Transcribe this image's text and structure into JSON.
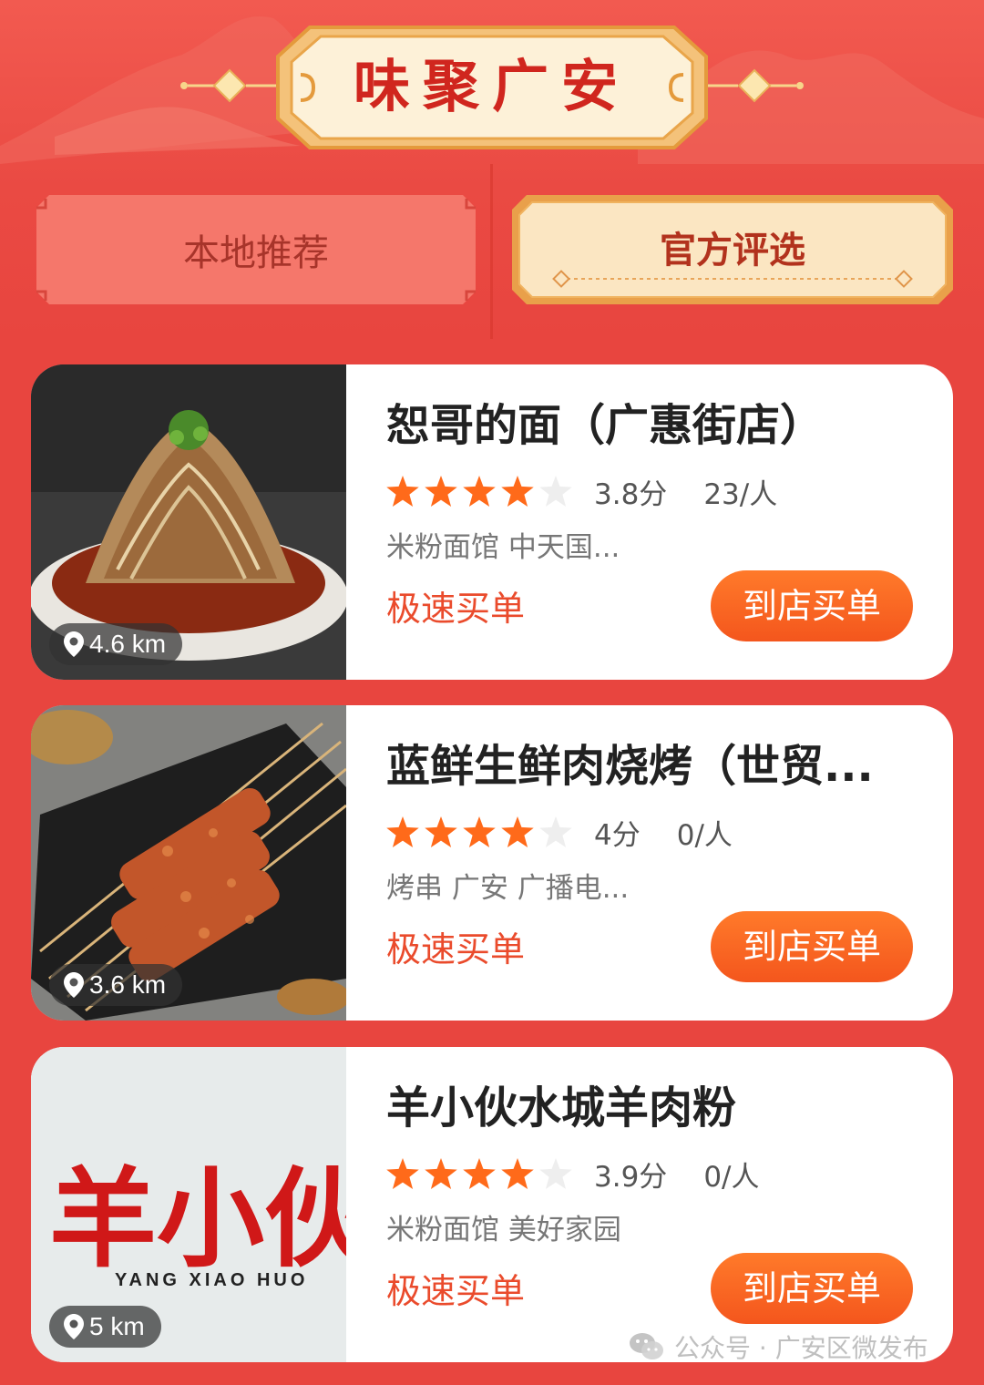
{
  "header": {
    "banner_title": "味聚广安",
    "tabs": [
      {
        "label": "本地推荐",
        "active": false
      },
      {
        "label": "官方评选",
        "active": true
      }
    ]
  },
  "colors": {
    "background": "#e8453f",
    "tab_local": "#f5776b",
    "tab_official": "#fbe6c2",
    "accent_orange": "#f4561d",
    "star_filled": "#ff6a1a",
    "star_empty": "#eeeeee"
  },
  "shops": [
    {
      "name": "恕哥的面（广惠街店）",
      "rating": 4,
      "score_text": "3.8分",
      "price_text": "23/人",
      "tags": "米粉面馆  中天国...",
      "fast_pay": "极速买单",
      "button": "到店买单",
      "distance": "4.6 km",
      "image_icon": "noodle-dish-photo"
    },
    {
      "name": "蓝鲜生鲜肉烧烤（世贸...",
      "rating": 4,
      "score_text": "4分",
      "price_text": "0/人",
      "tags": "烤串  广安 广播电...",
      "fast_pay": "极速买单",
      "button": "到店买单",
      "distance": "3.6 km",
      "image_icon": "bbq-skewers-photo"
    },
    {
      "name": "羊小伙水城羊肉粉",
      "rating": 4,
      "score_text": "3.9分",
      "price_text": "0/人",
      "tags": "米粉面馆  美好家园",
      "fast_pay": "极速买单",
      "button": "到店买单",
      "distance": "5 km",
      "image_icon": "yang-xiao-huo-logo",
      "logo_text": "羊小伙",
      "logo_subtext": "YANG XIAO HUO"
    }
  ],
  "watermark": "公众号 · 广安区微发布"
}
